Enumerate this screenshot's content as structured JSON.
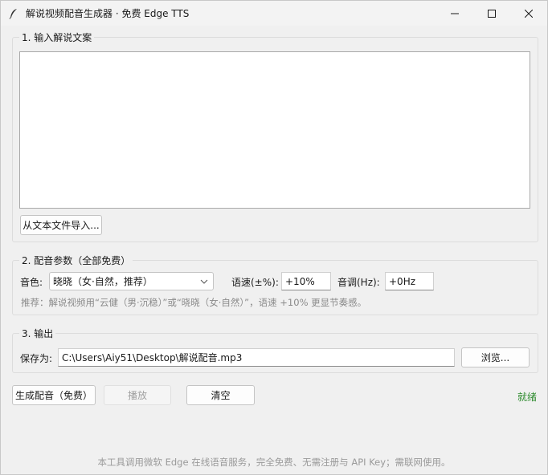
{
  "window": {
    "title": "解说视频配音生成器 · 免费 Edge TTS"
  },
  "sections": {
    "input": {
      "label": "1. 输入解说文案",
      "text": "",
      "import_button": "从文本文件导入..."
    },
    "params": {
      "label": "2. 配音参数（全部免费）",
      "voice_label": "音色:",
      "voice_value": "晓晓（女·自然，推荐）",
      "rate_label": "语速(±%):",
      "rate_value": "+10%",
      "pitch_label": "音调(Hz):",
      "pitch_value": "+0Hz",
      "tip": "推荐：解说视频用“云健（男·沉稳）”或“晓晓（女·自然）”，语速 +10% 更显节奏感。"
    },
    "output": {
      "label": "3. 输出",
      "save_label": "保存为:",
      "save_path": "C:\\Users\\Aiy51\\Desktop\\解说配音.mp3",
      "browse_button": "浏览..."
    }
  },
  "actions": {
    "generate_button": "生成配音（免费）",
    "play_button": "播放",
    "clear_button": "清空",
    "status": "就绪",
    "status_color": "#2e8b2e"
  },
  "footer": "本工具调用微软 Edge 在线语音服务，完全免费、无需注册与 API Key；需联网使用。"
}
